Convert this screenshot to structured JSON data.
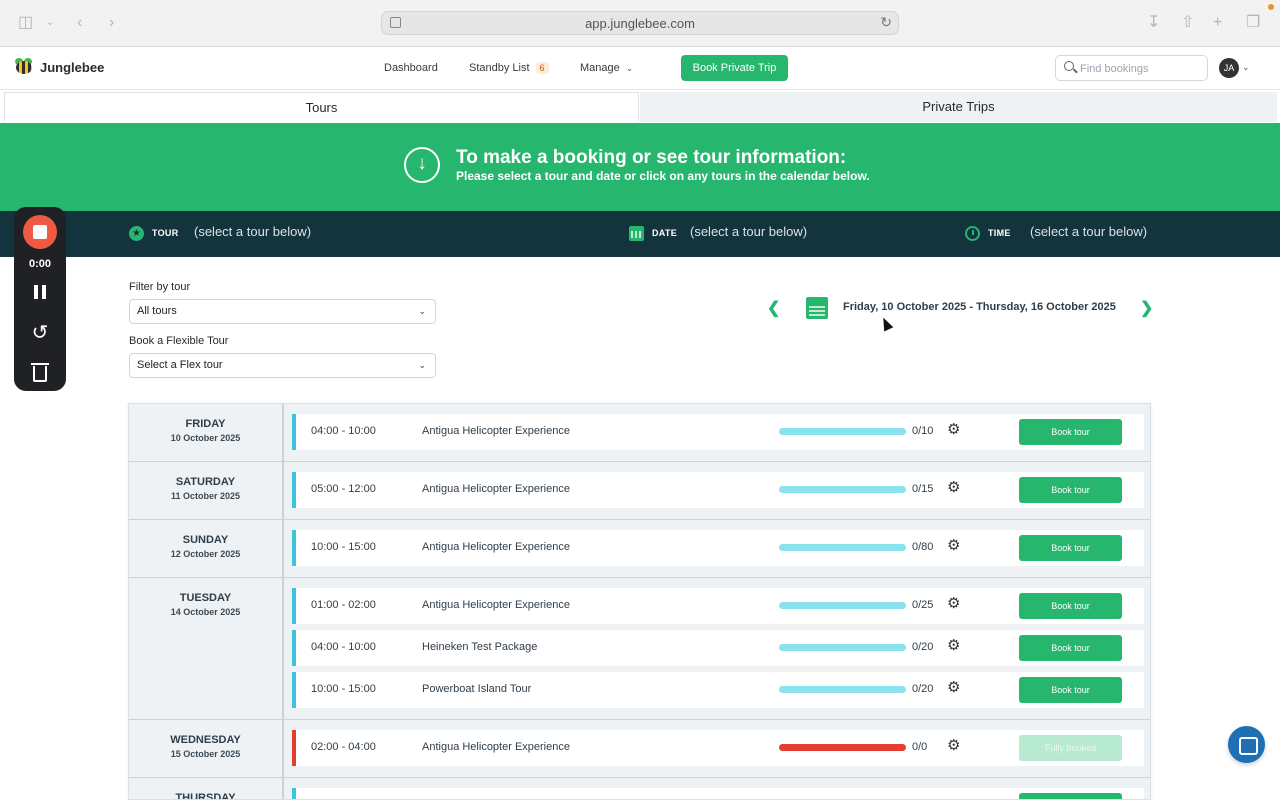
{
  "browser": {
    "url": "app.junglebee.com"
  },
  "nav": {
    "brand": "Junglebee",
    "links": {
      "dashboard": "Dashboard",
      "standby": "Standby List",
      "standby_count": "6",
      "manage": "Manage"
    },
    "book_private": "Book Private Trip",
    "search_placeholder": "Find bookings",
    "avatar_initials": "JA"
  },
  "tabs": {
    "tours": "Tours",
    "private": "Private Trips"
  },
  "banner": {
    "title": "To make a booking or see tour information:",
    "subtitle": "Please select a tour and date or click on any tours in the calendar below."
  },
  "infobar": {
    "tour_label": "TOUR",
    "tour_value": "(select a tour below)",
    "date_label": "DATE",
    "date_value": "(select a tour below)",
    "time_label": "TIME",
    "time_value": "(select a tour below)"
  },
  "recorder": {
    "time": "0:00"
  },
  "filters": {
    "filter_label": "Filter by tour",
    "filter_value": "All tours",
    "flex_label": "Book a Flexible Tour",
    "flex_value": "Select a Flex tour"
  },
  "range": {
    "text": "Friday, 10 October 2025 - Thursday, 16 October 2025"
  },
  "days": [
    {
      "name": "FRIDAY",
      "date": "10 October 2025",
      "tours": [
        {
          "time": "04:00 - 10:00",
          "name": "Antigua Helicopter Experience",
          "capacity": "0/10",
          "action": "Book tour",
          "status": "available"
        }
      ]
    },
    {
      "name": "SATURDAY",
      "date": "11 October 2025",
      "tours": [
        {
          "time": "05:00 - 12:00",
          "name": "Antigua Helicopter Experience",
          "capacity": "0/15",
          "action": "Book tour",
          "status": "available"
        }
      ]
    },
    {
      "name": "SUNDAY",
      "date": "12 October 2025",
      "tours": [
        {
          "time": "10:00 - 15:00",
          "name": "Antigua Helicopter Experience",
          "capacity": "0/80",
          "action": "Book tour",
          "status": "available"
        }
      ]
    },
    {
      "name": "TUESDAY",
      "date": "14 October 2025",
      "tours": [
        {
          "time": "01:00 - 02:00",
          "name": "Antigua Helicopter Experience",
          "capacity": "0/25",
          "action": "Book tour",
          "status": "available"
        },
        {
          "time": "04:00 - 10:00",
          "name": "Heineken Test Package",
          "capacity": "0/20",
          "action": "Book tour",
          "status": "available"
        },
        {
          "time": "10:00 - 15:00",
          "name": "Powerboat Island Tour",
          "capacity": "0/20",
          "action": "Book tour",
          "status": "available"
        }
      ]
    },
    {
      "name": "WEDNESDAY",
      "date": "15 October 2025",
      "tours": [
        {
          "time": "02:00 - 04:00",
          "name": "Antigua Helicopter Experience",
          "capacity": "0/0",
          "action": "Fully booked",
          "status": "full"
        }
      ]
    },
    {
      "name": "THURSDAY",
      "date": "",
      "tours": [
        {
          "time": "",
          "name": "",
          "capacity": "",
          "action": "",
          "status": "available"
        }
      ]
    }
  ],
  "colors": {
    "brand_green": "#27b66d",
    "info_bar": "#13343d",
    "capacity_bar": "#89e2ee",
    "full_red": "#e53e30"
  },
  "icons": [
    "sidebar-icon",
    "back-icon",
    "forward-icon",
    "reload-icon",
    "download-icon",
    "share-icon",
    "new-tab-icon",
    "tabs-icon",
    "search-icon",
    "star-icon",
    "calendar-icon",
    "alarm-clock-icon",
    "gear-icon",
    "chat-icon"
  ]
}
